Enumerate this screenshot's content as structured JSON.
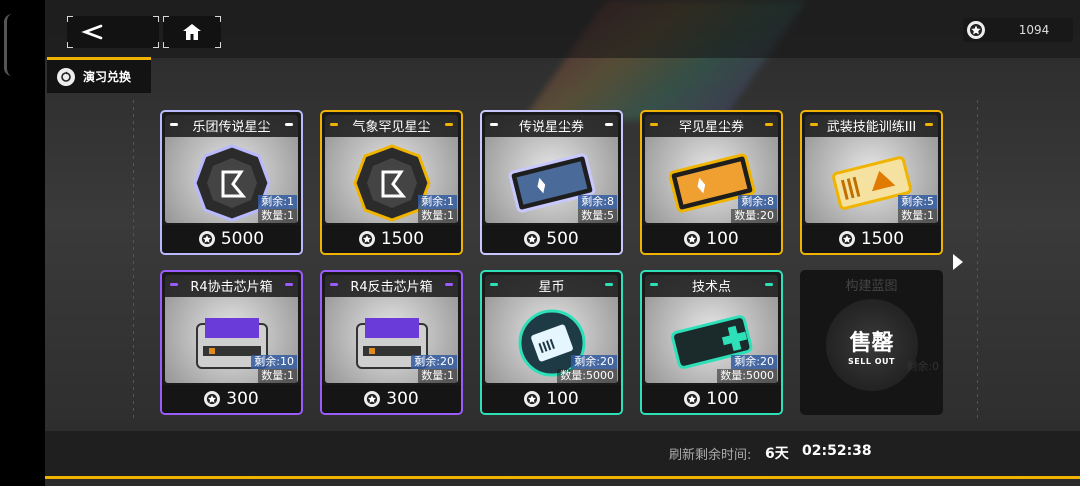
{
  "header": {
    "back_icon": "chevron-left-icon",
    "home_icon": "home-icon",
    "currency_amount": "1094"
  },
  "tab": {
    "label": "演习兑换"
  },
  "cards": [
    {
      "title": "乐团传说星尘",
      "remaining": "剩余:1",
      "quantity": "数量:1",
      "price": "5000",
      "frame_color": "#b9b9ff",
      "tick_color": "#ffffff"
    },
    {
      "title": "气象罕见星尘",
      "remaining": "剩余:1",
      "quantity": "数量:1",
      "price": "1500",
      "frame_color": "#f0b400",
      "tick_color": "#f0b400"
    },
    {
      "title": "传说星尘券",
      "remaining": "剩余:8",
      "quantity": "数量:5",
      "price": "500",
      "frame_color": "#c8c8ff",
      "tick_color": "#ffffff"
    },
    {
      "title": "罕见星尘券",
      "remaining": "剩余:8",
      "quantity": "数量:20",
      "price": "100",
      "frame_color": "#f0b400",
      "tick_color": "#f0b400"
    },
    {
      "title": "武装技能训练III",
      "remaining": "剩余:5",
      "quantity": "数量:1",
      "price": "1500",
      "frame_color": "#f0b400",
      "tick_color": "#f0b400"
    },
    {
      "title": "R4协击芯片箱",
      "remaining": "剩余:10",
      "quantity": "数量:1",
      "price": "300",
      "frame_color": "#9b5cff",
      "tick_color": "#9b5cff"
    },
    {
      "title": "R4反击芯片箱",
      "remaining": "剩余:20",
      "quantity": "数量:1",
      "price": "300",
      "frame_color": "#9b5cff",
      "tick_color": "#9b5cff"
    },
    {
      "title": "星币",
      "remaining": "剩余:20",
      "quantity": "数量:5000",
      "price": "100",
      "frame_color": "#2ee0b8",
      "tick_color": "#2ee0b8"
    },
    {
      "title": "技术点",
      "remaining": "剩余:20",
      "quantity": "数量:5000",
      "price": "100",
      "frame_color": "#2ee0b8",
      "tick_color": "#2ee0b8"
    }
  ],
  "sold_out_card": {
    "title": "构建蓝图",
    "badge_zh": "售罄",
    "badge_en": "SELL OUT",
    "remaining": "剩余:0"
  },
  "footer": {
    "refresh_label": "刷新剩余时间:",
    "refresh_days": "6天",
    "refresh_time": "02:52:38"
  }
}
